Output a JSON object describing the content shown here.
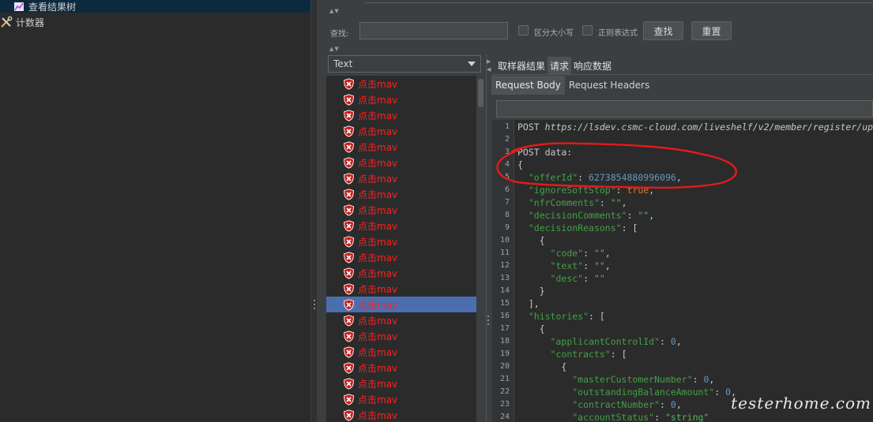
{
  "tree": {
    "items": [
      {
        "label": "查看结果树",
        "icon": "chart-listener-icon",
        "selected": true
      },
      {
        "label": "计数器",
        "icon": "tools-config-icon",
        "selected": false
      }
    ]
  },
  "search": {
    "label": "查找:",
    "value": "",
    "case_label": "区分大小写",
    "regex_label": "正则表达式",
    "find_button": "查找",
    "reset_button": "重置"
  },
  "results": {
    "format": "Text",
    "samples": [
      {
        "label": "点击mav"
      },
      {
        "label": "点击mav"
      },
      {
        "label": "点击mav"
      },
      {
        "label": "点击mav"
      },
      {
        "label": "点击mav"
      },
      {
        "label": "点击mav"
      },
      {
        "label": "点击mav"
      },
      {
        "label": "点击mav"
      },
      {
        "label": "点击mav"
      },
      {
        "label": "点击mav"
      },
      {
        "label": "点击mav"
      },
      {
        "label": "点击mav"
      },
      {
        "label": "点击mav"
      },
      {
        "label": "点击mav"
      },
      {
        "label": "点击mav",
        "selected": true
      },
      {
        "label": "点击mav"
      },
      {
        "label": "点击mav"
      },
      {
        "label": "点击mav"
      },
      {
        "label": "点击mav"
      },
      {
        "label": "点击mav"
      },
      {
        "label": "点击mav"
      },
      {
        "label": "点击mav"
      }
    ]
  },
  "tabs": [
    "取样器结果",
    "请求",
    "响应数据"
  ],
  "active_tab": 1,
  "subtabs": [
    "Request Body",
    "Request Headers"
  ],
  "active_subtab": 0,
  "code_lines": [
    {
      "n": "1",
      "parts": [
        [
          "t",
          "POST "
        ],
        [
          "url",
          "https://lsdev.csmc-cloud.com/liveshelf/v2/member/register/up"
        ]
      ]
    },
    {
      "n": "2",
      "parts": []
    },
    {
      "n": "3",
      "parts": [
        [
          "t",
          "POST data:"
        ]
      ]
    },
    {
      "n": "4",
      "parts": [
        [
          "t",
          "{"
        ]
      ]
    },
    {
      "n": "5",
      "parts": [
        [
          "t",
          "  "
        ],
        [
          "key",
          "\"offerId\""
        ],
        [
          "t",
          ": "
        ],
        [
          "num",
          "6273854880996096"
        ],
        [
          "t",
          ","
        ]
      ]
    },
    {
      "n": "6",
      "parts": [
        [
          "t",
          "  "
        ],
        [
          "key",
          "\"ignoreSoftStop\""
        ],
        [
          "t",
          ": "
        ],
        [
          "lit",
          "true"
        ],
        [
          "t",
          ","
        ]
      ]
    },
    {
      "n": "7",
      "parts": [
        [
          "t",
          "  "
        ],
        [
          "key",
          "\"nfrComments\""
        ],
        [
          "t",
          ": "
        ],
        [
          "str",
          "\"\""
        ],
        [
          "t",
          ","
        ]
      ]
    },
    {
      "n": "8",
      "parts": [
        [
          "t",
          "  "
        ],
        [
          "key",
          "\"decisionComments\""
        ],
        [
          "t",
          ": "
        ],
        [
          "str",
          "\"\""
        ],
        [
          "t",
          ","
        ]
      ]
    },
    {
      "n": "9",
      "parts": [
        [
          "t",
          "  "
        ],
        [
          "key",
          "\"decisionReasons\""
        ],
        [
          "t",
          ": ["
        ]
      ]
    },
    {
      "n": "10",
      "parts": [
        [
          "t",
          "    {"
        ]
      ]
    },
    {
      "n": "11",
      "parts": [
        [
          "t",
          "      "
        ],
        [
          "key",
          "\"code\""
        ],
        [
          "t",
          ": "
        ],
        [
          "str",
          "\"\""
        ],
        [
          "t",
          ","
        ]
      ]
    },
    {
      "n": "12",
      "parts": [
        [
          "t",
          "      "
        ],
        [
          "key",
          "\"text\""
        ],
        [
          "t",
          ": "
        ],
        [
          "str",
          "\"\""
        ],
        [
          "t",
          ","
        ]
      ]
    },
    {
      "n": "13",
      "parts": [
        [
          "t",
          "      "
        ],
        [
          "key",
          "\"desc\""
        ],
        [
          "t",
          ": "
        ],
        [
          "str",
          "\"\""
        ]
      ]
    },
    {
      "n": "14",
      "parts": [
        [
          "t",
          "    }"
        ]
      ]
    },
    {
      "n": "15",
      "parts": [
        [
          "t",
          "  ],"
        ]
      ]
    },
    {
      "n": "16",
      "parts": [
        [
          "t",
          "  "
        ],
        [
          "key",
          "\"histories\""
        ],
        [
          "t",
          ": ["
        ]
      ]
    },
    {
      "n": "17",
      "parts": [
        [
          "t",
          "    {"
        ]
      ]
    },
    {
      "n": "18",
      "parts": [
        [
          "t",
          "      "
        ],
        [
          "key",
          "\"applicantControlId\""
        ],
        [
          "t",
          ": "
        ],
        [
          "num",
          "0"
        ],
        [
          "t",
          ","
        ]
      ]
    },
    {
      "n": "19",
      "parts": [
        [
          "t",
          "      "
        ],
        [
          "key",
          "\"contracts\""
        ],
        [
          "t",
          ": ["
        ]
      ]
    },
    {
      "n": "20",
      "parts": [
        [
          "t",
          "        {"
        ]
      ]
    },
    {
      "n": "21",
      "parts": [
        [
          "t",
          "          "
        ],
        [
          "key",
          "\"masterCustomerNumber\""
        ],
        [
          "t",
          ": "
        ],
        [
          "num",
          "0"
        ],
        [
          "t",
          ","
        ]
      ]
    },
    {
      "n": "22",
      "parts": [
        [
          "t",
          "          "
        ],
        [
          "key",
          "\"outstandingBalanceAmount\""
        ],
        [
          "t",
          ": "
        ],
        [
          "num",
          "0"
        ],
        [
          "t",
          ","
        ]
      ]
    },
    {
      "n": "23",
      "parts": [
        [
          "t",
          "          "
        ],
        [
          "key",
          "\"contractNumber\""
        ],
        [
          "t",
          ": "
        ],
        [
          "num",
          "0"
        ],
        [
          "t",
          ","
        ]
      ]
    },
    {
      "n": "24",
      "parts": [
        [
          "t",
          "          "
        ],
        [
          "key",
          "\"accountStatus\""
        ],
        [
          "t",
          ": "
        ],
        [
          "str",
          "\"string\""
        ]
      ]
    }
  ],
  "watermark": "testerhome.com"
}
